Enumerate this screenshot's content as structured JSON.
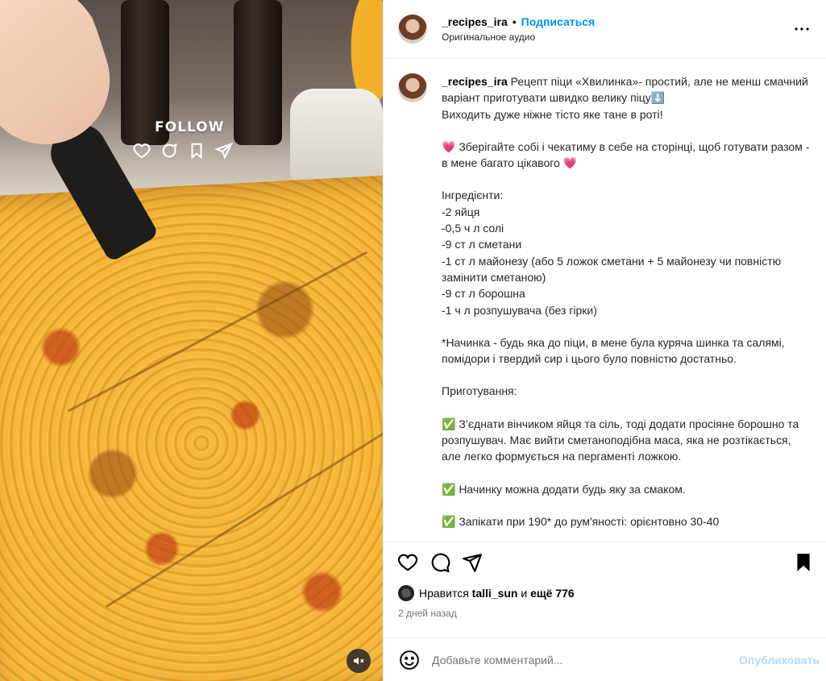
{
  "media": {
    "overlay_follow": "FOLLOW"
  },
  "header": {
    "username": "_recipes_ira",
    "separator": "•",
    "follow_label": "Подписаться",
    "audio_label": "Оригинальное аудио"
  },
  "caption": {
    "username": "_recipes_ira",
    "lines": [
      "Рецепт піци «Хвилинка»- простий, але не менш смачний варіант приготувати швидко велику піцу⬇️",
      "Виходить дуже ніжне тісто яке тане в роті!",
      "",
      "💗 Зберігайте собі і чекатиму в себе на сторінці, щоб готувати разом - в мене багато цікавого 💗",
      "",
      "Інгредієнти:",
      "-2 яйця",
      "-0,5 ч л солі",
      "-9 ст л сметани",
      "-1 ст л майонезу (або 5 ложок сметани + 5 майонезу чи повністю замінити сметаною)",
      "-9 ст л борошна",
      "-1 ч л розпушувача (без гірки)",
      "",
      "*Начинка - будь яка до піци, в мене була куряча шинка та салямі, помідори і твердий сир і цього було повністю достатньо.",
      "",
      "Приготування:",
      "",
      "✅ З’єднати вінчиком яйця та сіль, тоді додати просіяне борошно та розпушувач. Має вийти сметаноподібна маса, яка не розтікається, але легко формується на пергаменті ложкою.",
      "",
      "✅ Начинку можна додати будь яку за смаком.",
      "",
      "✅ Запікати при 190* до рум'яності: орієнтовно 30-40"
    ]
  },
  "likes": {
    "prefix": "Нравится",
    "user": "talli_sun",
    "conj": "и",
    "others": "ещё 776"
  },
  "timestamp": "2 дней назад",
  "comment": {
    "placeholder": "Добавьте комментарий...",
    "post_label": "Опубликовать"
  },
  "colors": {
    "link_blue": "#0095f6",
    "post_disabled": "#b3dbff",
    "muted_text": "#737373"
  },
  "icons": [
    "heart-icon",
    "comment-icon",
    "share-icon",
    "bookmark-icon",
    "more-icon",
    "emoji-icon",
    "mute-icon"
  ]
}
